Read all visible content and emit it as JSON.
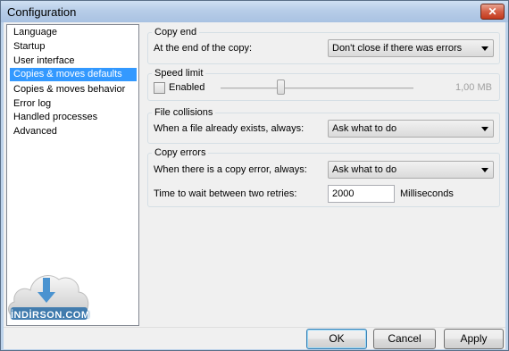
{
  "window": {
    "title": "Configuration",
    "close_glyph": "✕"
  },
  "nav": {
    "items": [
      "Language",
      "Startup",
      "User interface",
      "Copies & moves defaults",
      "Copies & moves behavior",
      "Error log",
      "Handled processes",
      "Advanced"
    ],
    "selected_index": 3
  },
  "copy_end": {
    "title": "Copy end",
    "label": "At the end of the copy:",
    "value": "Don't close if there was errors"
  },
  "speed_limit": {
    "title": "Speed limit",
    "checkbox_label": "Enabled",
    "checked": false,
    "slider_level": 0.31,
    "value_text": "1,00 MB"
  },
  "file_collisions": {
    "title": "File collisions",
    "label": "When a file already exists, always:",
    "value": "Ask what to do"
  },
  "copy_errors": {
    "title": "Copy errors",
    "label": "When there is a copy error, always:",
    "value": "Ask what to do",
    "retry_label": "Time to wait between two retries:",
    "retry_value": "2000",
    "retry_unit": "Milliseconds"
  },
  "buttons": {
    "ok": "OK",
    "cancel": "Cancel",
    "apply": "Apply"
  },
  "watermark": {
    "text": "İNDİRSON.COM"
  },
  "colors": {
    "selection": "#3399ff",
    "titlebar": "#b7cde8",
    "close": "#c2391d"
  }
}
